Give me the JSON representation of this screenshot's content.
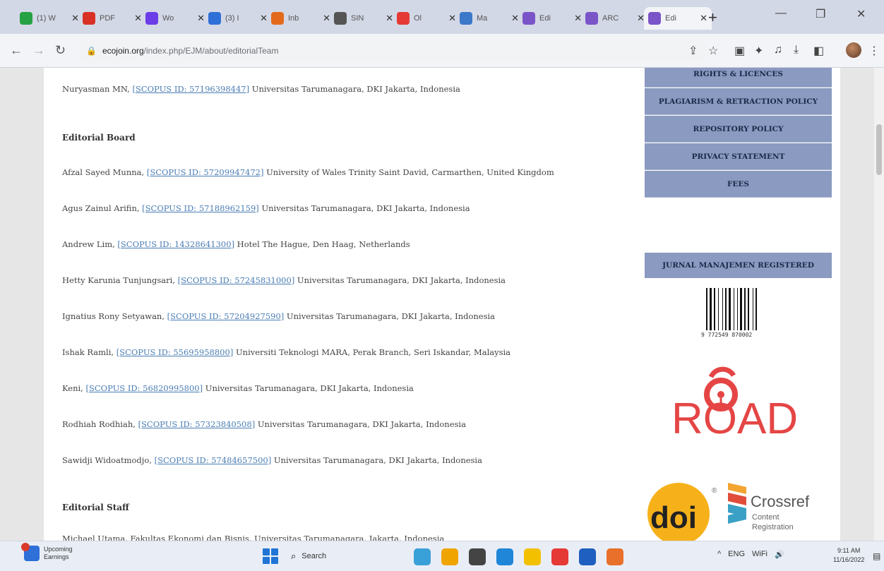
{
  "browser": {
    "tabs": [
      {
        "title": "(1) W",
        "color": "#25a244",
        "active": false
      },
      {
        "title": "PDF",
        "color": "#d93025",
        "active": false
      },
      {
        "title": "Wo",
        "color": "#6a3de8",
        "active": false
      },
      {
        "title": "(3) I",
        "color": "#2f6fd8",
        "active": false
      },
      {
        "title": "Inb",
        "color": "#e46a1b",
        "active": false
      },
      {
        "title": "SIN",
        "color": "#555555",
        "active": false
      },
      {
        "title": "Ol",
        "color": "#e53935",
        "active": false
      },
      {
        "title": "Ma",
        "color": "#3b78c9",
        "active": false
      },
      {
        "title": "Edi",
        "color": "#7a55c8",
        "active": false
      },
      {
        "title": "ARC",
        "color": "#7a55c8",
        "active": false
      },
      {
        "title": "Edi",
        "color": "#7a55c8",
        "active": true
      }
    ],
    "new_tab": "+",
    "window_controls": {
      "minimize": "—",
      "maximize": "❐",
      "close": "✕"
    },
    "url_host": "ecojoin.org",
    "url_path": "/index.php/EJM/about/editorialTeam"
  },
  "article": {
    "chief_line": {
      "name": "Nuryasman MN, ",
      "scopus": "[SCOPUS ID: 57196398447]",
      "affil": " Universitas Tarumanagara, DKI Jakarta, Indonesia"
    },
    "board_heading": "Editorial Board",
    "board": [
      {
        "name": "Afzal Sayed Munna, ",
        "scopus": "[SCOPUS ID: 57209947472]",
        "affil": " University of Wales Trinity Saint David, Carmarthen, United Kingdom"
      },
      {
        "name": "Agus Zainul Arifin, ",
        "scopus": "[SCOPUS ID: 57188962159]",
        "affil": " Universitas Tarumanagara, DKI Jakarta, Indonesia"
      },
      {
        "name": "Andrew Lim, ",
        "scopus": "[SCOPUS ID: 14328641300]",
        "affil": " Hotel The Hague, Den Haag, Netherlands"
      },
      {
        "name": "Hetty Karunia Tunjungsari, ",
        "scopus": "[SCOPUS ID: 57245831000]",
        "affil": " Universitas Tarumanagara, DKI Jakarta, Indonesia"
      },
      {
        "name": "Ignatius Rony Setyawan, ",
        "scopus": "[SCOPUS ID: 57204927590]",
        "affil": " Universitas Tarumanagara, DKI Jakarta, Indonesia"
      },
      {
        "name": "Ishak Ramli, ",
        "scopus": "[SCOPUS ID: 55695958800]",
        "affil": " Universiti Teknologi MARA, Perak Branch, Seri Iskandar, Malaysia"
      },
      {
        "name": "Keni, ",
        "scopus": "[SCOPUS ID: 56820995800]",
        "affil": " Universitas Tarumanagara, DKI Jakarta, Indonesia"
      },
      {
        "name": "Rodhiah Rodhiah, ",
        "scopus": "[SCOPUS ID: 57323840508]",
        "affil": " Universitas Tarumanagara, DKI Jakarta, Indonesia"
      },
      {
        "name": "Sawidji Widoatmodjo, ",
        "scopus": "[SCOPUS ID: 57484657500]",
        "affil": " Universitas Tarumanagara, DKI Jakarta, Indonesia"
      }
    ],
    "staff_heading": "Editorial Staff",
    "staff_partial": "Michael Utama, Fakultas Ekonomi dan Bisnis, Universitas Tarumanagara, Jakarta, Indonesia"
  },
  "sidebar": {
    "menu": [
      "RIGHTS & LICENCES",
      "PLAGIARISM & RETRACTION POLICY",
      "REPOSITORY POLICY",
      "PRIVACY STATEMENT",
      "FEES"
    ],
    "registered": "JURNAL MANAJEMEN REGISTERED",
    "barcode_number": "9 772549 870002",
    "road_text": "ROAD",
    "doi_text": "doi",
    "crossref_title": "Crossref",
    "crossref_sub1": "Content",
    "crossref_sub2": "Registration"
  },
  "taskbar": {
    "weather_line1": "Upcoming",
    "weather_line2": "Earnings",
    "search_label": "Search",
    "apps": [
      {
        "name": "files",
        "color": "#3aa0d8"
      },
      {
        "name": "chat",
        "color": "#f0a400"
      },
      {
        "name": "media",
        "color": "#444444"
      },
      {
        "name": "edge",
        "color": "#1f86d8"
      },
      {
        "name": "explorer",
        "color": "#f3c000"
      },
      {
        "name": "chrome",
        "color": "#e53935"
      },
      {
        "name": "outlook",
        "color": "#1f5fbf"
      },
      {
        "name": "office",
        "color": "#e8702a"
      }
    ],
    "tray": {
      "caret": "^",
      "lang": "ENG",
      "wifi": "WiFi",
      "sound": "🔊"
    },
    "time": "9:11 AM",
    "date": "11/16/2022"
  }
}
